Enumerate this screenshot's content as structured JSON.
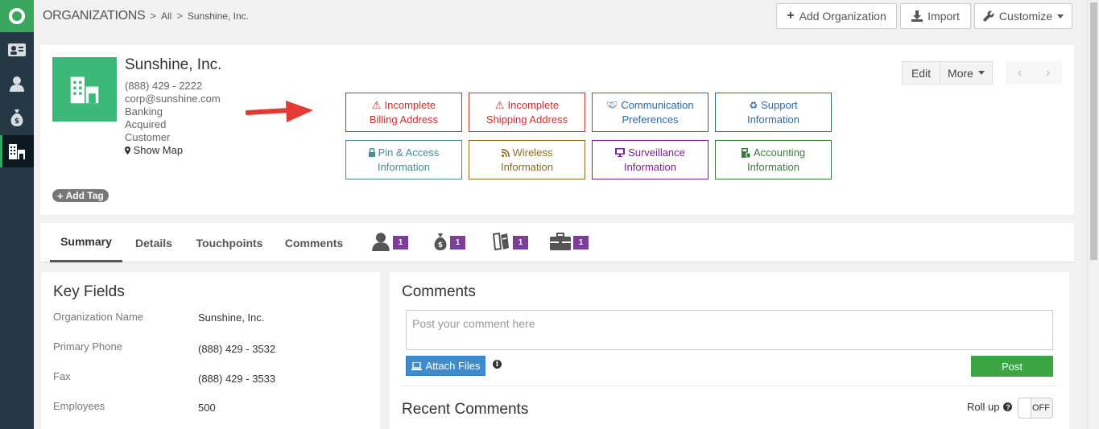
{
  "topbar": {
    "module": "ORGANIZATIONS",
    "crumb_all": "All",
    "crumb_current": "Sunshine, Inc.",
    "add_label": "Add Organization",
    "import_label": "Import",
    "customize_label": "Customize"
  },
  "org": {
    "name": "Sunshine, Inc.",
    "phone": "(888) 429 - 2222",
    "email": "corp@sunshine.com",
    "industry": "Banking",
    "status": "Acquired",
    "type": "Customer",
    "show_map": "Show Map",
    "add_tag": "Add Tag"
  },
  "header_buttons": {
    "edit": "Edit",
    "more": "More"
  },
  "alerts": [
    {
      "line1": "Incomplete",
      "line2": "Billing Address",
      "icon": "warning-icon",
      "color": "#c9302c"
    },
    {
      "line1": "Incomplete",
      "line2": "Shipping Address",
      "icon": "warning-icon",
      "color": "#c9302c"
    },
    {
      "line1": "Communication",
      "line2": "Preferences",
      "icon": "handshake-icon",
      "color": "#2f6aa8"
    },
    {
      "line1": "Support",
      "line2": "Information",
      "icon": "recycle-icon",
      "color": "#2f6aa8"
    },
    {
      "line1": "Pin & Access",
      "line2": "Information",
      "icon": "lock-icon",
      "color": "#4a8c8c"
    },
    {
      "line1": "Wireless",
      "line2": "Information",
      "icon": "rss-icon",
      "color": "#8a6d1e"
    },
    {
      "line1": "Surveillance",
      "line2": "Information",
      "icon": "monitor-icon",
      "color": "#7a1fa2"
    },
    {
      "line1": "Accounting",
      "line2": "Information",
      "icon": "calculator-icon",
      "color": "#3c7a3c"
    }
  ],
  "tabs": {
    "summary": "Summary",
    "details": "Details",
    "touchpoints": "Touchpoints",
    "comments": "Comments",
    "contacts_count": "1",
    "deals_count": "1",
    "tickets_count": "1",
    "projects_count": "1"
  },
  "key_fields": {
    "title": "Key Fields",
    "rows": [
      {
        "label": "Organization Name",
        "value": "Sunshine, Inc."
      },
      {
        "label": "Primary Phone",
        "value": "(888) 429 - 3532"
      },
      {
        "label": "Fax",
        "value": "(888) 429 - 3533"
      },
      {
        "label": "Employees",
        "value": "500"
      }
    ]
  },
  "comments": {
    "title": "Comments",
    "placeholder": "Post your comment here",
    "attach_label": "Attach Files",
    "post_label": "Post",
    "recent_title": "Recent Comments",
    "rollup_label": "Roll up",
    "toggle_state": "OFF"
  },
  "colors": {
    "nav_bg": "#253846",
    "accent_green": "#3aa55d",
    "badge_purple": "#7b3f99",
    "attach_blue": "#428bca",
    "arrow_red": "#e53935"
  }
}
